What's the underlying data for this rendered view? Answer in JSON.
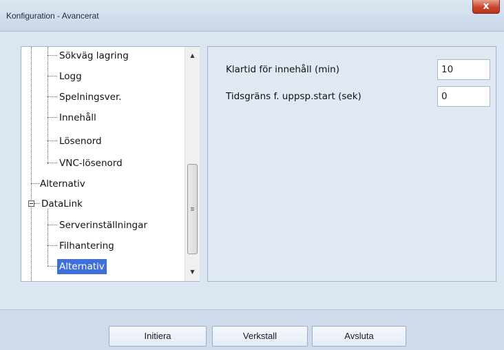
{
  "window": {
    "title": "Konfiguration - Avancerat",
    "close_glyph": "x"
  },
  "tree": {
    "items": [
      {
        "label": "Sökväg lagring"
      },
      {
        "label": "Logg"
      },
      {
        "label": "Spelningsver."
      },
      {
        "label": "Innehåll"
      },
      {
        "label": "Lösenord"
      },
      {
        "label": "VNC-lösenord"
      },
      {
        "label": "Alternativ"
      },
      {
        "label": "DataLink"
      },
      {
        "label": "Serverinställningar"
      },
      {
        "label": "Filhantering"
      },
      {
        "label": "Alternativ",
        "selected": true
      }
    ],
    "scroll_up_glyph": "▲",
    "scroll_down_glyph": "▼"
  },
  "settings": {
    "rows": [
      {
        "label": "Klartid för innehåll (min)",
        "value": "10"
      },
      {
        "label": "Tidsgräns f. uppsp.start (sek)",
        "value": "0"
      }
    ]
  },
  "buttons": {
    "initiera": "Initiera",
    "verkstall": "Verkstall",
    "avsluta": "Avsluta"
  }
}
